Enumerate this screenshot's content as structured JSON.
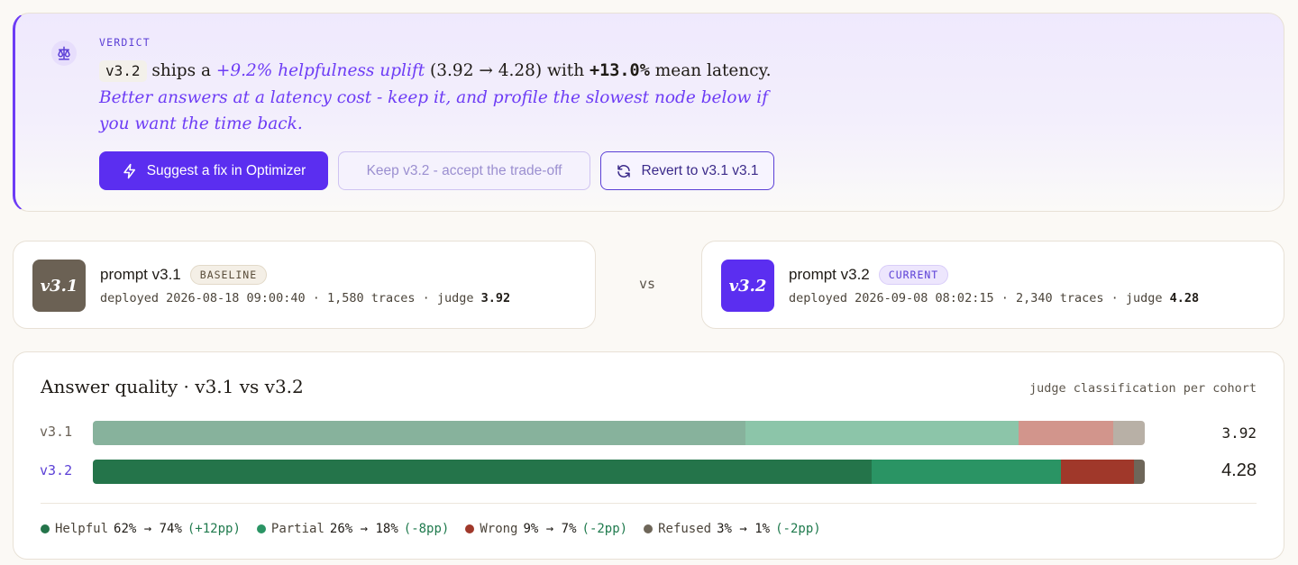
{
  "verdict": {
    "label": "VERDICT",
    "version_chip": "v3.2",
    "text_ships": " ships a ",
    "uplift": "+9.2% helpfulness uplift",
    "scores": " (3.92 → 4.28) with ",
    "latency": "+13.0%",
    "latency_suffix": " mean latency. ",
    "advice": "Better answers at a latency cost - keep it, and profile the slowest node below if you want the time back.",
    "buttons": {
      "suggest": "Suggest a fix in Optimizer",
      "keep": "Keep v3.2 - accept the trade-off",
      "revert": "Revert to v3.1 v3.1"
    },
    "icons": {
      "verdict": "scale-icon",
      "suggest": "lightning-icon",
      "revert": "refresh-icon"
    }
  },
  "baseline": {
    "badge": "v3.1",
    "title": "prompt v3.1",
    "tag": "BASELINE",
    "meta": "deployed 2026-08-18 09:00:40 · 1,580 traces · judge ",
    "judge": "3.92"
  },
  "vs_label": "vs",
  "current": {
    "badge": "v3.2",
    "title": "prompt v3.2",
    "tag": "CURRENT",
    "meta": "deployed 2026-09-08 08:02:15 · 2,340 traces · judge ",
    "judge": "4.28"
  },
  "quality": {
    "title": "Answer quality · v3.1 vs v3.2",
    "subtitle": "judge classification per cohort",
    "rows": [
      {
        "label": "v3.1",
        "score": "3.92",
        "segments": [
          {
            "name": "Helpful",
            "value": 62,
            "color": "#87b29c"
          },
          {
            "name": "Partial",
            "value": 26,
            "color": "#8cc5a9"
          },
          {
            "name": "Wrong",
            "value": 9,
            "color": "#d2958c"
          },
          {
            "name": "Refused",
            "value": 3,
            "color": "#b8b0a6"
          }
        ]
      },
      {
        "label": "v3.2",
        "score": "4.28",
        "segments": [
          {
            "name": "Helpful",
            "value": 74,
            "color": "#24744a"
          },
          {
            "name": "Partial",
            "value": 18,
            "color": "#2a9464"
          },
          {
            "name": "Wrong",
            "value": 7,
            "color": "#a0382a"
          },
          {
            "name": "Refused",
            "value": 1,
            "color": "#6e6659"
          }
        ]
      }
    ],
    "legend": [
      {
        "name": "Helpful",
        "change": "62% → 74%",
        "delta": "(+12pp)",
        "color": "#24744a"
      },
      {
        "name": "Partial",
        "change": "26% → 18%",
        "delta": "(-8pp)",
        "color": "#2a9464"
      },
      {
        "name": "Wrong",
        "change": "9% → 7%",
        "delta": "(-2pp)",
        "color": "#a0382a"
      },
      {
        "name": "Refused",
        "change": "3% → 1%",
        "delta": "(-2pp)",
        "color": "#6e6659"
      }
    ]
  }
}
